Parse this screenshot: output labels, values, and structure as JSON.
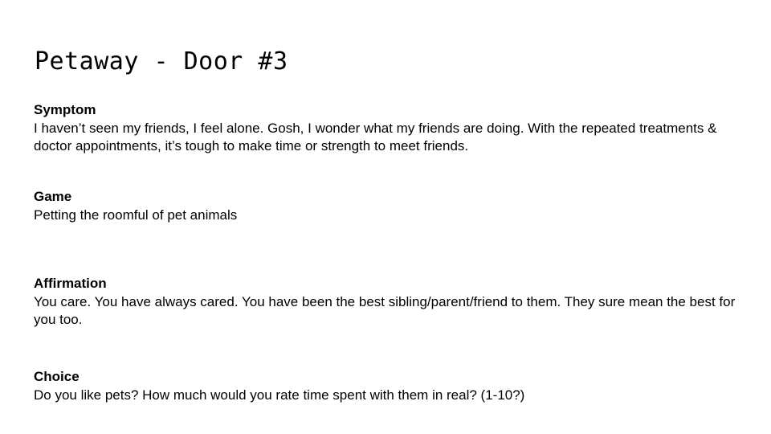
{
  "slide": {
    "title": "Petaway - Door #3",
    "sections": [
      {
        "heading": "Symptom",
        "body": "I haven’t seen my friends, I feel alone. Gosh, I wonder what my friends are doing. With the repeated treatments & doctor appointments, it’s tough to make time or strength to meet friends."
      },
      {
        "heading": "Game",
        "body": "Petting the roomful of pet animals"
      },
      {
        "heading": "Affirmation",
        "body": "You care. You have always cared. You have been the best sibling/parent/friend to them. They sure mean the best for you too."
      },
      {
        "heading": "Choice",
        "body": "Do you like pets? How much would you rate time spent with them in real? (1-10?)"
      }
    ]
  }
}
